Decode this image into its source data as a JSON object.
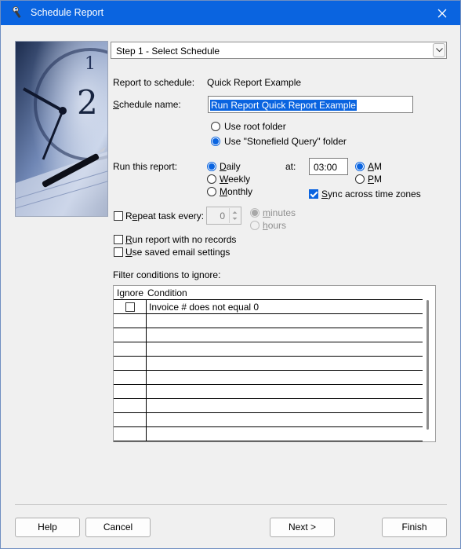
{
  "window": {
    "title": "Schedule Report",
    "icon": "wrench-app-icon",
    "accent": "#0a64e0"
  },
  "step_selector": {
    "value": "Step 1 - Select Schedule"
  },
  "report": {
    "label": "Report to schedule:",
    "value": "Quick Report Example"
  },
  "schedule_name": {
    "label": "Schedule name:",
    "value": "Run Report Quick Report Example"
  },
  "folder": {
    "options": [
      "Use root folder",
      "Use \"Stonefield Query\" folder"
    ],
    "selected": "Use \"Stonefield Query\" folder"
  },
  "run": {
    "label": "Run this report:",
    "options": [
      "Daily",
      "Weekly",
      "Monthly"
    ],
    "selected": "Daily",
    "at_label": "at:",
    "time": "03:00",
    "ampm_options": [
      "AM",
      "PM"
    ],
    "ampm_selected": "AM",
    "sync_label": "Sync across time zones",
    "sync_checked": true
  },
  "repeat": {
    "label": "Repeat task every:",
    "checked": false,
    "value": "0",
    "unit_options": [
      "minutes",
      "hours"
    ],
    "unit_selected": "minutes"
  },
  "options": {
    "no_records_label": "Run report with no records",
    "no_records_checked": false,
    "saved_email_label": "Use saved email settings",
    "saved_email_checked": false
  },
  "filter": {
    "label": "Filter conditions to ignore:",
    "columns": [
      "Ignore",
      "Condition"
    ],
    "rows": [
      {
        "ignore": false,
        "condition": "Invoice # does not equal 0"
      }
    ]
  },
  "buttons": {
    "help": "Help",
    "cancel": "Cancel",
    "next": "Next >",
    "finish": "Finish"
  }
}
